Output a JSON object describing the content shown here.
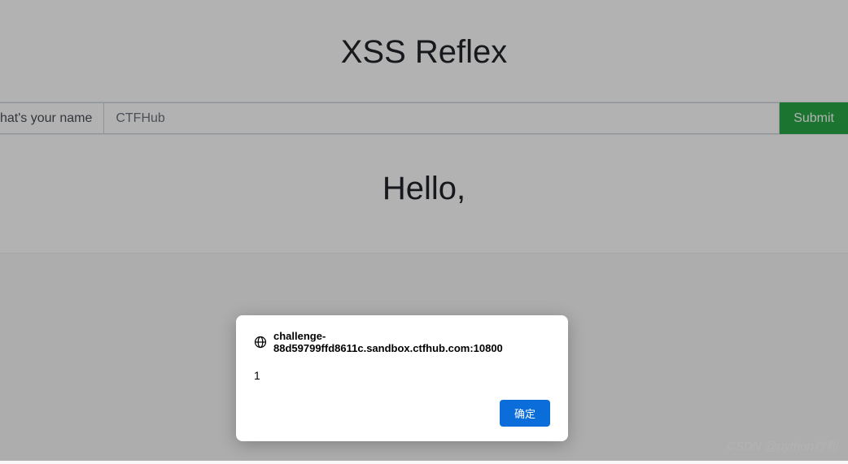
{
  "page": {
    "title": "XSS Reflex",
    "greeting": "Hello,"
  },
  "form": {
    "label": "hat's your name",
    "placeholder": "CTFHub",
    "submit_label": "Submit"
  },
  "dialog": {
    "domain": "challenge-88d59799ffd8611c.sandbox.ctfhub.com:10800",
    "message": "1",
    "ok_label": "确定"
  },
  "watermark": "CSDN @python炒粉"
}
